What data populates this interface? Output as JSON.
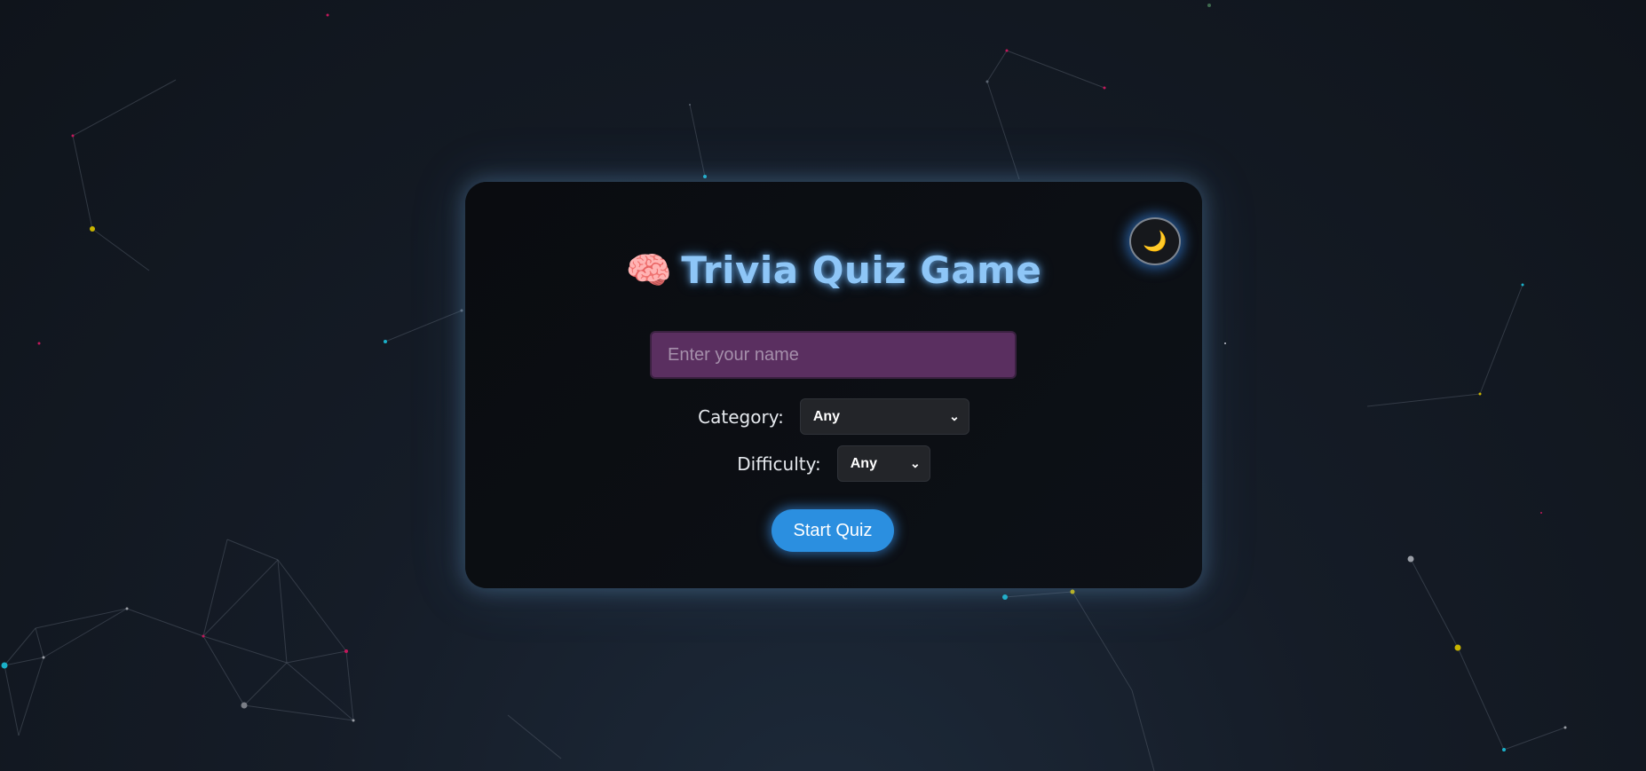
{
  "header": {
    "title": "Trivia Quiz Game",
    "title_icon": "brain-icon",
    "title_emoji": "🧠"
  },
  "theme_toggle": {
    "icon": "moon-icon",
    "glyph": "🌙"
  },
  "form": {
    "name_placeholder": "Enter your name",
    "name_value": "",
    "category_label": "Category:",
    "category_selected": "Any",
    "difficulty_label": "Difficulty:",
    "difficulty_selected": "Any",
    "start_label": "Start Quiz"
  },
  "colors": {
    "title": "#8ec6f7",
    "input_background": "#5a2f60",
    "button": "#2b8fe0",
    "card": "#0a0c10",
    "page_background": "#151c27"
  }
}
